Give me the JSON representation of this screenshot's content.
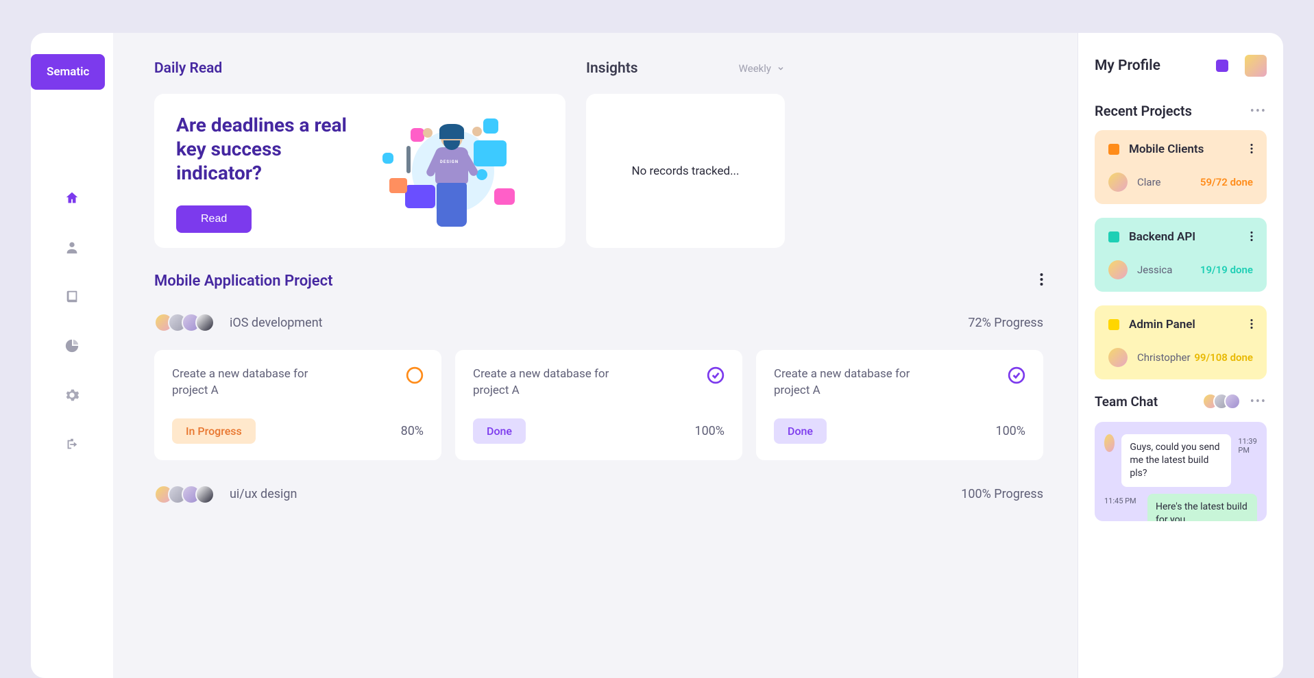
{
  "brand": "Sematic",
  "dailyRead": {
    "header": "Daily Read",
    "articleTitle": "Are deadlines a real key success indicator?",
    "readBtn": "Read"
  },
  "insights": {
    "title": "Insights",
    "dropdown": "Weekly",
    "empty": "No records tracked..."
  },
  "project": {
    "title": "Mobile Application Project",
    "sub1": {
      "name": "iOS development",
      "progress": "72% Progress"
    },
    "sub2": {
      "name": "ui/ux design",
      "progress": "100% Progress"
    },
    "tasks": [
      {
        "desc": "Create a new database for project A",
        "badge": "In Progress",
        "percent": "80%"
      },
      {
        "desc": "Create a new database for project A",
        "badge": "Done",
        "percent": "100%"
      },
      {
        "desc": "Create a new database for project A",
        "badge": "Done",
        "percent": "100%"
      }
    ]
  },
  "profile": {
    "title": "My Profile",
    "recentTitle": "Recent Projects",
    "projects": [
      {
        "name": "Mobile Clients",
        "person": "Clare",
        "done": "59/72 done"
      },
      {
        "name": "Backend API",
        "person": "Jessica",
        "done": "19/19 done"
      },
      {
        "name": "Admin Panel",
        "person": "Christopher",
        "done": "99/108 done"
      }
    ],
    "chatTitle": "Team Chat",
    "chat": [
      {
        "text": "Guys, could you send me the latest build pls?",
        "time": "11:39 PM"
      },
      {
        "text": "Here's the latest build for you.",
        "time": "11:45 PM"
      }
    ]
  }
}
